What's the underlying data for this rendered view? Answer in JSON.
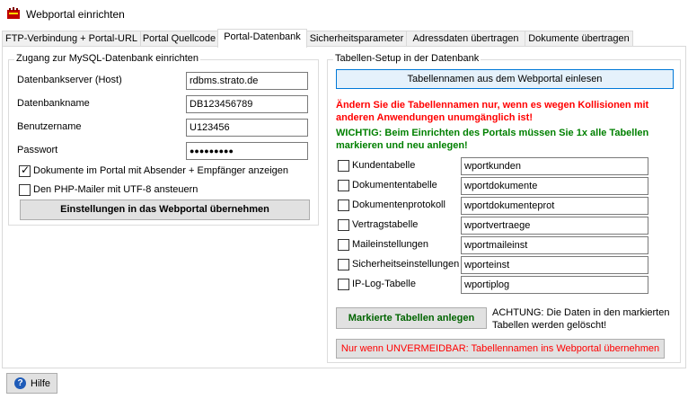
{
  "window": {
    "title": "Webportal einrichten"
  },
  "tabs": [
    {
      "label": "FTP-Verbindung + Portal-URL"
    },
    {
      "label": "Portal Quellcode"
    },
    {
      "label": "Portal-Datenbank"
    },
    {
      "label": "Sicherheitsparameter"
    },
    {
      "label": "Adressdaten übertragen"
    },
    {
      "label": "Dokumente übertragen"
    }
  ],
  "mysql": {
    "title": "Zugang zur MySQL-Datenbank einrichten",
    "fields": [
      {
        "label": "Datenbankserver (Host)",
        "value": "rdbms.strato.de"
      },
      {
        "label": "Datenbankname",
        "value": "DB123456789"
      },
      {
        "label": "Benutzername",
        "value": "U123456"
      },
      {
        "label": "Passwort",
        "value": "●●●●●●●●●"
      }
    ],
    "checkboxes": [
      {
        "label": "Dokumente im Portal mit Absender + Empfänger anzeigen",
        "checked": true
      },
      {
        "label": "Den PHP-Mailer mit UTF-8 ansteuern",
        "checked": false
      }
    ],
    "apply_button": "Einstellungen in das Webportal übernehmen"
  },
  "tables": {
    "title": "Tabellen-Setup in der Datenbank",
    "read_button": "Tabellennamen aus dem Webportal einlesen",
    "warning_red": "Ändern Sie die Tabellennamen nur, wenn es wegen Kollisionen mit anderen Anwendungen unumgänglich ist!",
    "warning_green": "WICHTIG: Beim Einrichten des Portals müssen Sie 1x alle Tabellen markieren und neu anlegen!",
    "rows": [
      {
        "label": "Kundentabelle",
        "value": "wportkunden",
        "checked": false
      },
      {
        "label": "Dokumententabelle",
        "value": "wportdokumente",
        "checked": false
      },
      {
        "label": "Dokumentenprotokoll",
        "value": "wportdokumenteprot",
        "checked": false
      },
      {
        "label": "Vertragstabelle",
        "value": "wportvertraege",
        "checked": false
      },
      {
        "label": "Maileinstellungen",
        "value": "wportmaileinst",
        "checked": false
      },
      {
        "label": "Sicherheitseinstellungen",
        "value": "wporteinst",
        "checked": false
      },
      {
        "label": "IP-Log-Tabelle",
        "value": "wportiplog",
        "checked": false
      }
    ],
    "create_button": "Markierte Tabellen anlegen",
    "create_note": "ACHTUNG: Die Daten in den markierten Tabellen werden gelöscht!",
    "transfer_button": "Nur wenn UNVERMEIDBAR: Tabellennamen ins Webportal übernehmen"
  },
  "help": {
    "label": "Hilfe",
    "icon": "help-icon"
  },
  "colors": {
    "red": "#ff0000",
    "green": "#008000",
    "button_green": "#006400",
    "focus": "#0078d7"
  }
}
